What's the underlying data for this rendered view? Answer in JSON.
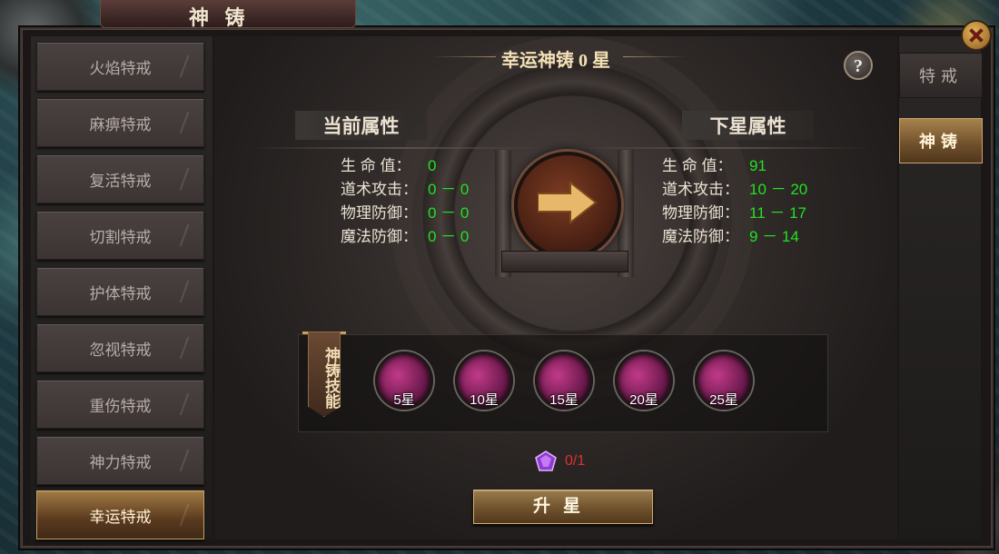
{
  "window": {
    "title": "神 铸"
  },
  "sidebar": {
    "items": [
      {
        "label": "火焰特戒"
      },
      {
        "label": "麻痹特戒"
      },
      {
        "label": "复活特戒"
      },
      {
        "label": "切割特戒"
      },
      {
        "label": "护体特戒"
      },
      {
        "label": "忽视特戒"
      },
      {
        "label": "重伤特戒"
      },
      {
        "label": "神力特戒"
      },
      {
        "label": "幸运特戒",
        "active": true
      }
    ]
  },
  "main": {
    "title": "幸运神铸 0 星",
    "help_label": "?",
    "current": {
      "header": "当前属性",
      "rows": [
        {
          "label": "生 命 值：",
          "value": "0"
        },
        {
          "label": "道术攻击：",
          "value": "0 － 0"
        },
        {
          "label": "物理防御：",
          "value": "0 － 0"
        },
        {
          "label": "魔法防御：",
          "value": "0 － 0"
        }
      ]
    },
    "next": {
      "header": "下星属性",
      "rows": [
        {
          "label": "生 命 值：",
          "value": "91"
        },
        {
          "label": "道术攻击：",
          "value": "10 － 20"
        },
        {
          "label": "物理防御：",
          "value": "11 － 17"
        },
        {
          "label": "魔法防御：",
          "value": "9 － 14"
        }
      ]
    },
    "skills": {
      "banner": "神铸技能",
      "items": [
        {
          "label": "5星"
        },
        {
          "label": "10星"
        },
        {
          "label": "15星"
        },
        {
          "label": "20星"
        },
        {
          "label": "25星"
        }
      ]
    },
    "cost": {
      "text": "0/1",
      "color": "#e03131"
    },
    "upgrade_label": "升星"
  },
  "right_tabs": [
    {
      "label": "特戒"
    },
    {
      "label": "神铸",
      "active": true
    }
  ],
  "colors": {
    "accent": "#c7a064",
    "value_green": "#22e022"
  }
}
